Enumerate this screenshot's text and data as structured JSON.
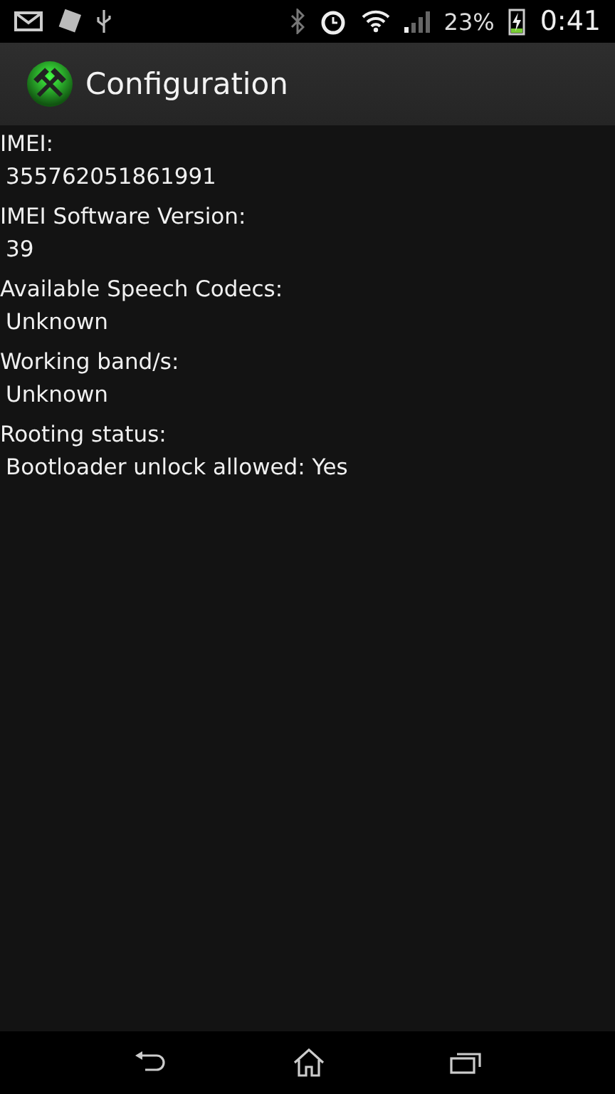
{
  "status_bar": {
    "battery": "23%",
    "time": "0:41"
  },
  "action_bar": {
    "title": "Configuration"
  },
  "fields": [
    {
      "label": "IMEI:",
      "value": "355762051861991"
    },
    {
      "label": "IMEI Software Version:",
      "value": "39"
    },
    {
      "label": "Available Speech Codecs:",
      "value": "Unknown"
    },
    {
      "label": "Working band/s:",
      "value": "Unknown"
    },
    {
      "label": "Rooting status:",
      "value": "Bootloader unlock allowed: Yes"
    }
  ]
}
